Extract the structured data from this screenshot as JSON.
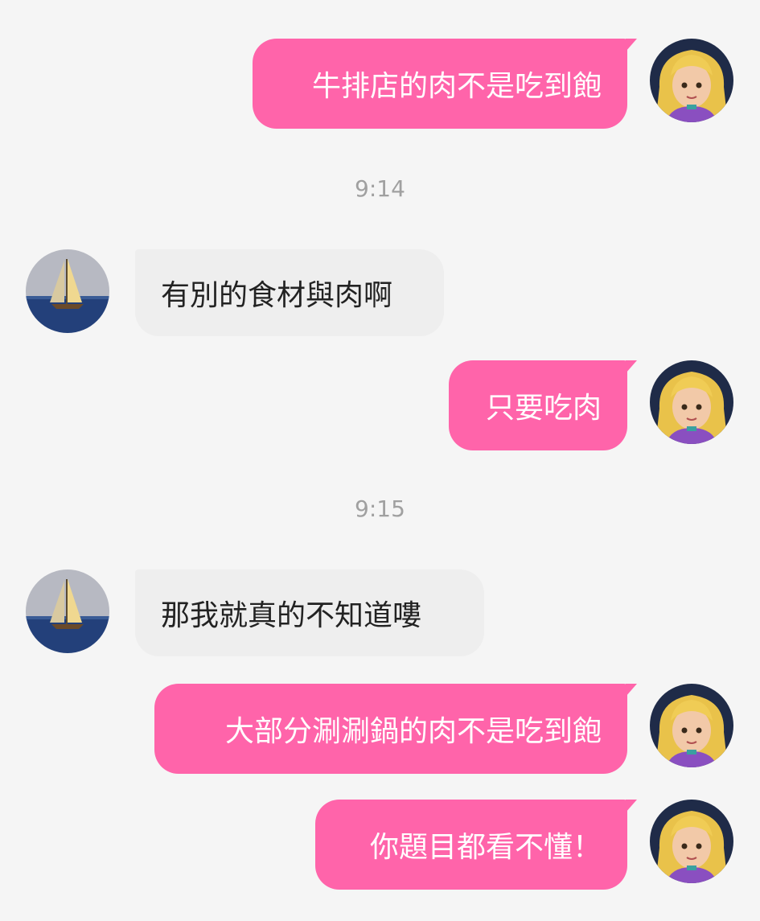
{
  "chat": {
    "messages": [
      {
        "side": "outgoing",
        "text": "牛排店的肉不是吃到飽"
      },
      {
        "side": "incoming",
        "text": "有別的食材與肉啊"
      },
      {
        "side": "outgoing",
        "text": "只要吃肉"
      },
      {
        "side": "incoming",
        "text": "那我就真的不知道嘍"
      },
      {
        "side": "outgoing",
        "text": "大部分涮涮鍋的肉不是吃到飽"
      },
      {
        "side": "outgoing",
        "text": "你題目都看不懂！"
      }
    ],
    "timestamps": [
      "9:14",
      "9:15"
    ]
  },
  "avatars": {
    "me": "blonde-girl-avatar",
    "other": "sailboat-avatar"
  },
  "colors": {
    "background": "#f5f5f5",
    "outgoing_bubble": "#ff64aa",
    "incoming_bubble": "#eeeeee",
    "timestamp": "#a0a0a0"
  }
}
